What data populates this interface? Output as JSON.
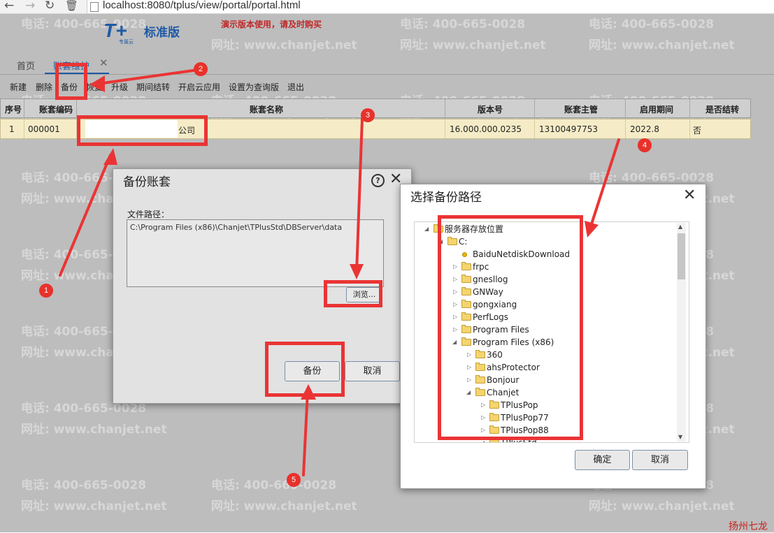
{
  "browser": {
    "url": "localhost:8080/tplus/view/portal/portal.html"
  },
  "header": {
    "logo_mark": "T+",
    "logo_sub": "专属云",
    "edition": "标准版",
    "demo_notice": "演示版本使用，请及时购买"
  },
  "watermark": {
    "phone": "电话: 400-665-0028",
    "site": "网址: www.chanjet.net"
  },
  "tabs": [
    {
      "label": "首页"
    },
    {
      "label": "账套维护"
    }
  ],
  "toolbar": [
    "新建",
    "删除",
    "备份",
    "恢复",
    "升级",
    "期间结转",
    "开启云应用",
    "设置为查询版",
    "退出"
  ],
  "table": {
    "headers": [
      "序号",
      "账套编码",
      "账套名称",
      "版本号",
      "账套主管",
      "启用期间",
      "是否结转"
    ],
    "rows": [
      [
        "1",
        "000001",
        "公司",
        "16.000.000.0235",
        "13100497753",
        "2022.8",
        "否"
      ]
    ]
  },
  "backup_dialog": {
    "title": "备份账套",
    "path_label": "文件路径：",
    "path_value": "C:\\Program Files (x86)\\Chanjet\\TPlusStd\\DBServer\\data",
    "browse": "浏览...",
    "ok": "备份",
    "cancel": "取消"
  },
  "path_dialog": {
    "title": "选择备份路径",
    "ok": "确定",
    "cancel": "取消",
    "tree": [
      {
        "label": "服务器存放位置",
        "expanded": true
      },
      {
        "label": "C:",
        "expanded": true
      },
      {
        "label": "BaiduNetdiskDownload"
      },
      {
        "label": "frpc"
      },
      {
        "label": "gnesllog"
      },
      {
        "label": "GNWay"
      },
      {
        "label": "gongxiang"
      },
      {
        "label": "PerfLogs"
      },
      {
        "label": "Program Files"
      },
      {
        "label": "Program Files (x86)",
        "expanded": true
      },
      {
        "label": "360"
      },
      {
        "label": "ahsProtector"
      },
      {
        "label": "Bonjour"
      },
      {
        "label": "Chanjet",
        "expanded": true
      },
      {
        "label": "TPlusPop"
      },
      {
        "label": "TPlusPop77"
      },
      {
        "label": "TPlusPop88"
      },
      {
        "label": "TPlusStd"
      }
    ]
  },
  "annotations": [
    "1",
    "2",
    "3",
    "4",
    "5"
  ],
  "signature": "扬州七龙",
  "colors": {
    "annotation": "#ea3434",
    "accent": "#1f5aa5",
    "selected_row": "#f5ecc7"
  }
}
